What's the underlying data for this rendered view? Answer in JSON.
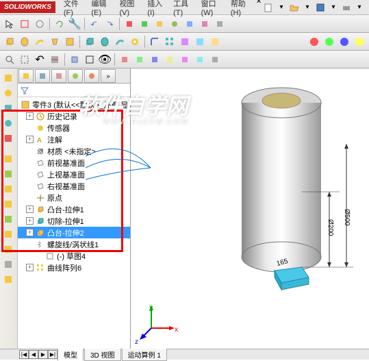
{
  "app": {
    "name": "SOLIDWORKS"
  },
  "menu": {
    "items": [
      "文件(F)",
      "编辑(E)",
      "视图(V)",
      "插入(I)",
      "工具(T)",
      "窗口(W)",
      "帮助(H)"
    ]
  },
  "tree": {
    "root": "零件3 (默认<<默认>_外观 显",
    "nodes": [
      {
        "label": "历史记录",
        "icon": "history",
        "exp": "+"
      },
      {
        "label": "传感器",
        "icon": "sensor",
        "exp": ""
      },
      {
        "label": "注解",
        "icon": "annot",
        "exp": "+"
      },
      {
        "label": "材质 <未指定>",
        "icon": "material",
        "exp": ""
      },
      {
        "label": "前视基准面",
        "icon": "plane",
        "exp": ""
      },
      {
        "label": "上视基准面",
        "icon": "plane",
        "exp": ""
      },
      {
        "label": "右视基准面",
        "icon": "plane",
        "exp": ""
      },
      {
        "label": "原点",
        "icon": "origin",
        "exp": ""
      },
      {
        "label": "凸台-拉伸1",
        "icon": "extrude",
        "exp": "+"
      },
      {
        "label": "切除-拉伸1",
        "icon": "cut",
        "exp": "+"
      },
      {
        "label": "凸台-拉伸2",
        "icon": "extrude",
        "exp": "+",
        "selected": true
      },
      {
        "label": "螺旋线/涡状线1",
        "icon": "helix",
        "exp": ""
      },
      {
        "label": "(-) 草图4",
        "icon": "sketch",
        "exp": "",
        "indent": 1
      },
      {
        "label": "曲线阵列6",
        "icon": "pattern",
        "exp": "+"
      }
    ]
  },
  "dimensions": {
    "d200": "Ø200",
    "d500": "Ø500",
    "h165": "165"
  },
  "triad": {
    "x": "x",
    "y": "y",
    "z": "z"
  },
  "bottom_tabs": {
    "scroll": [
      "|◀",
      "◀",
      "▶",
      "▶|"
    ],
    "tabs": [
      "模型",
      "3D 视图",
      "运动算例 1"
    ]
  },
  "watermark": {
    "main": "软件自学网",
    "sub": "WWW.RJZXW.COM"
  }
}
